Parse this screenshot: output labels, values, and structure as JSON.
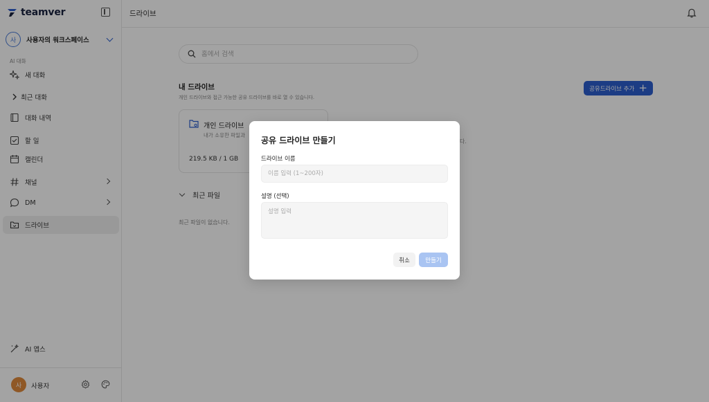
{
  "app": {
    "brand": "teamver"
  },
  "sidebar": {
    "workspace": {
      "avatar": "사",
      "name": "사용자의 워크스페이스"
    },
    "section_label": "AI 대화",
    "items": [
      {
        "label": "새 대화",
        "icon": "sparkles-icon"
      },
      {
        "label": "최근 대화",
        "icon": "chevron-right-icon"
      },
      {
        "label": "대화 내역",
        "icon": "book-icon"
      },
      {
        "label": "할 일",
        "icon": "checkbox-icon"
      },
      {
        "label": "캘린더",
        "icon": "calendar-icon"
      },
      {
        "label": "채널",
        "icon": "hash-icon"
      },
      {
        "label": "DM",
        "icon": "chat-bubble-icon"
      },
      {
        "label": "드라이브",
        "icon": "folder-icon"
      },
      {
        "label": "AI 앱스",
        "icon": "magic-wand-icon"
      }
    ],
    "user": {
      "avatar": "사",
      "name": "사용자"
    }
  },
  "topbar": {
    "title": "드라이브"
  },
  "main": {
    "search_placeholder": "홈에서 검색",
    "my_drive": {
      "title": "내 드라이브",
      "description": "개인 드라이브와 접근 가능한 공유 드라이브를 바로 열 수 있습니다.",
      "add_shared_label": "공유드라이브 추가"
    },
    "personal_drive": {
      "title": "개인 드라이브",
      "subtitle": "내가 소유한 파일과",
      "usage": "219.5 KB / 1 GB"
    },
    "recent_files": {
      "title": "최근 파일",
      "empty": "최근 파일이 없습니다."
    },
    "behind_text": "다."
  },
  "modal": {
    "title": "공유 드라이브 만들기",
    "name_label": "드라이브 이름",
    "name_placeholder": "이름 입력 (1~200자)",
    "desc_label": "설명 (선택)",
    "desc_placeholder": "설명 입력",
    "cancel_label": "취소",
    "create_label": "만들기"
  },
  "colors": {
    "accent": "#2c5fcf",
    "create_disabled": "#a9c4f2",
    "user_avatar": "#e08a3c"
  }
}
